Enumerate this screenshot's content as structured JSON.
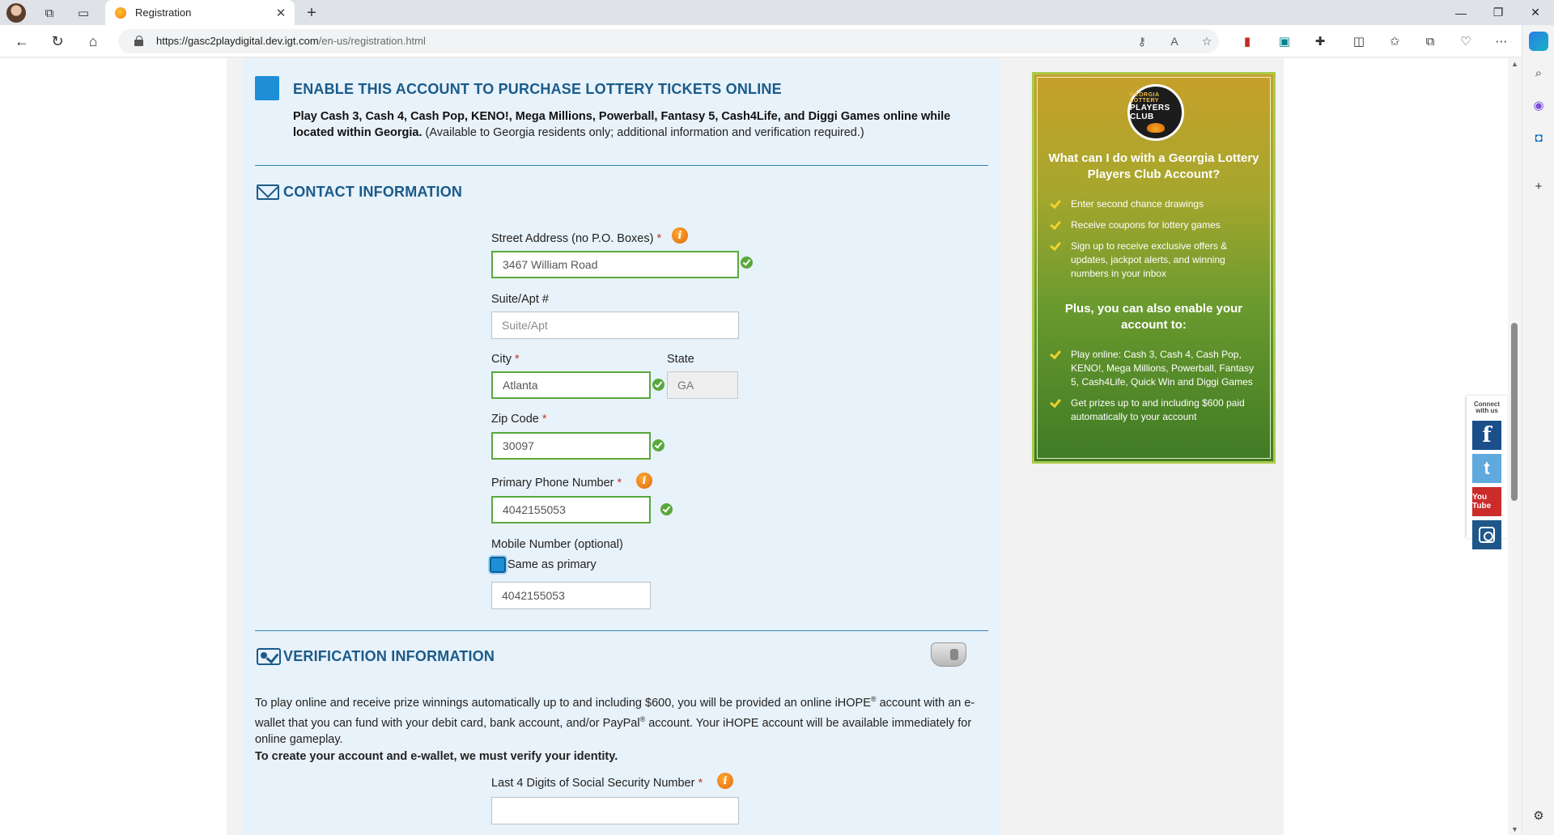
{
  "browser": {
    "tab_title": "Registration",
    "url_host": "https://gasc2playdigital.dev.igt.com",
    "url_path": "/en-us/registration.html",
    "new_tab_symbol": "+",
    "close_symbol": "✕"
  },
  "enable": {
    "title": "ENABLE THIS ACCOUNT TO PURCHASE LOTTERY TICKETS ONLINE",
    "desc_bold": "Play Cash 3, Cash 4, Cash Pop, KENO!, Mega Millions, Powerball, Fantasy 5, Cash4Life, and Diggi Games online while located within Georgia.",
    "desc_rest": " (Available to Georgia residents only; additional information and verification required.)",
    "accent": "#1e8fd6"
  },
  "contact": {
    "title": "CONTACT INFORMATION",
    "street_label": "Street Address (no P.O. Boxes)",
    "street_value": "3467 William Road",
    "suite_label": "Suite/Apt #",
    "suite_placeholder": "Suite/Apt",
    "city_label": "City",
    "city_value": "Atlanta",
    "state_label": "State",
    "state_value": "GA",
    "zip_label": "Zip Code",
    "zip_value": "30097",
    "phone_label": "Primary Phone Number",
    "phone_value": "4042155053",
    "mobile_label": "Mobile Number (optional)",
    "same_as_primary": "Same as primary",
    "mobile_value": "4042155053",
    "required_mark": "*"
  },
  "verification": {
    "title": "VERIFICATION INFORMATION",
    "para1_a": "To play online and receive prize winnings automatically up to and including $600, you will be provided an online iHOPE",
    "reg": "®",
    "para1_b": " account with an e-wallet that you can fund with your debit card, bank account, and/or PayPal",
    "para1_c": " account. Your iHOPE account will be available immediately for online gameplay.",
    "para2": "To create your account and e-wallet, we must verify your identity.",
    "ssn_label": "Last 4 Digits of Social Security Number",
    "ssn_value": ""
  },
  "promo": {
    "logo_top": "GEORGIA LOTTERY",
    "logo_main": "PLAYERS CLUB",
    "heading1": "What can I do with a Georgia Lottery Players Club Account?",
    "list1": [
      "Enter second chance drawings",
      "Receive coupons for lottery games",
      "Sign up to receive exclusive offers & updates, jackpot alerts, and winning numbers in your inbox"
    ],
    "heading2": "Plus, you can also enable your account to:",
    "list2": [
      "Play online: Cash 3, Cash 4, Cash Pop, KENO!, Mega Millions, Powerball, Fantasy 5, Cash4Life, Quick Win and Diggi Games",
      "Get prizes up to and including $600 paid automatically to your account"
    ]
  },
  "social": {
    "label": "Connect with us",
    "facebook": "f",
    "twitter": "t",
    "youtube": "You Tube"
  },
  "colors": {
    "heading_blue": "#1a5b8a",
    "valid_green": "#5aa83c",
    "info_orange": "#f07f13",
    "panel_bg": "#e8f2fa"
  }
}
